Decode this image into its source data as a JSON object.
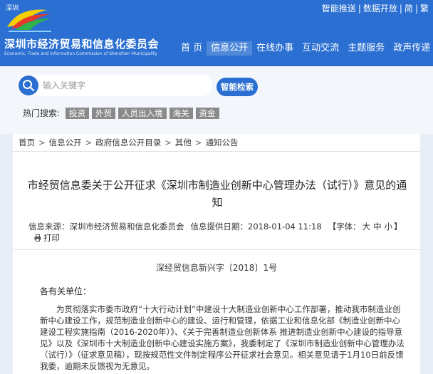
{
  "top_links": [
    "智能推送",
    "数据开放",
    "简",
    "繁"
  ],
  "site": {
    "logo_text": "深圳",
    "title": "深圳市经济贸易和信息化委员会",
    "subtitle": "Economic, Trade and Information Commission of Shenzhen Municipality"
  },
  "nav": [
    "首 页",
    "信息公开",
    "在线办事",
    "互动交流",
    "主题服务",
    "政声传递"
  ],
  "nav_active": 1,
  "search": {
    "placeholder": "输入关键字",
    "button": "智能检索",
    "hot_label": "热门搜索:",
    "hot_tags": [
      "投资",
      "外贸",
      "人员出入境",
      "海关",
      "资金"
    ]
  },
  "breadcrumb": [
    "首页",
    "信息公开",
    "政府信息公开目录",
    "其他",
    "通知公告"
  ],
  "article": {
    "title": "市经贸信息委关于公开征求《深圳市制造业创新中心管理办法（试行）》意见的通知",
    "source_label": "信息来源：",
    "source": "深圳市经济贸易和信息化委员会",
    "date_label": "信息提供日期：",
    "date": "2018-01-04 11:18",
    "font_label": "【字体：",
    "font_sizes": [
      "大",
      "中",
      "小"
    ],
    "font_end": "】",
    "print": "打印",
    "doc_number": "深经贸信息新兴字〔2018〕1号",
    "addressee": "各有关单位：",
    "body": "为贯彻落实市委市政府“十大行动计划”中建设十大制造业创新中心工作部署，推动我市制造业创新中心建设工作，规范制造业创新中心的建设、运行和管理，依据工业和信息化部《制造业创新中心建设工程实施指南（2016-2020年）》、《关于完善制造业创新体系 推进制造业创新中心建设的指导意见》以及《深圳市十大制造业创新中心建设实施方案》，我委制定了《深圳市制造业创新中心管理办法（试行）》（征求意见稿），现按规范性文件制定程序公开征求社会意见。相关意见请于1月10日前反馈我委，逾期未反馈视为无意见。"
  },
  "colors": {
    "header_bg": "#2a6fd1",
    "accent": "#2a6fd1",
    "tag_bg": "#8a8a8a",
    "page_bg": "#e9eef6"
  },
  "icons": [
    "logo-icon",
    "search-icon",
    "print-icon"
  ]
}
